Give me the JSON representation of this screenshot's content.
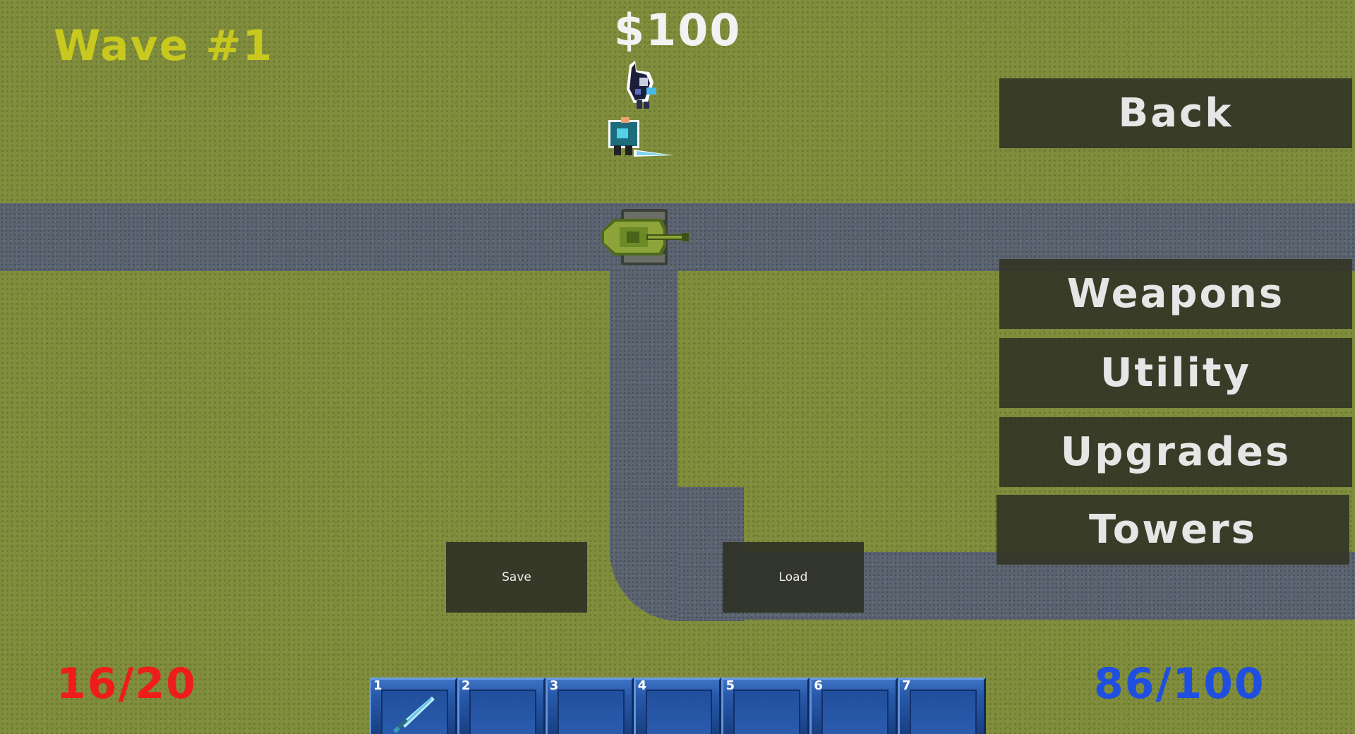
{
  "hud": {
    "wave": "Wave #1",
    "money": "$100",
    "lives": "16/20",
    "energy": "86/100"
  },
  "menu": {
    "back": "Back",
    "weapons": "Weapons",
    "utility": "Utility",
    "upgrades": "Upgrades",
    "towers": "Towers"
  },
  "file_buttons": {
    "save": "Save",
    "load": "Load"
  },
  "hotbar": {
    "slots": [
      {
        "number": "1",
        "item": "sword-icon"
      },
      {
        "number": "2",
        "item": ""
      },
      {
        "number": "3",
        "item": ""
      },
      {
        "number": "4",
        "item": ""
      },
      {
        "number": "5",
        "item": ""
      },
      {
        "number": "6",
        "item": ""
      },
      {
        "number": "7",
        "item": ""
      }
    ]
  },
  "colors": {
    "wave": "#c8c81e",
    "lives": "#ee1c1c",
    "energy": "#1f4fe0",
    "money": "#f2f2f2"
  }
}
